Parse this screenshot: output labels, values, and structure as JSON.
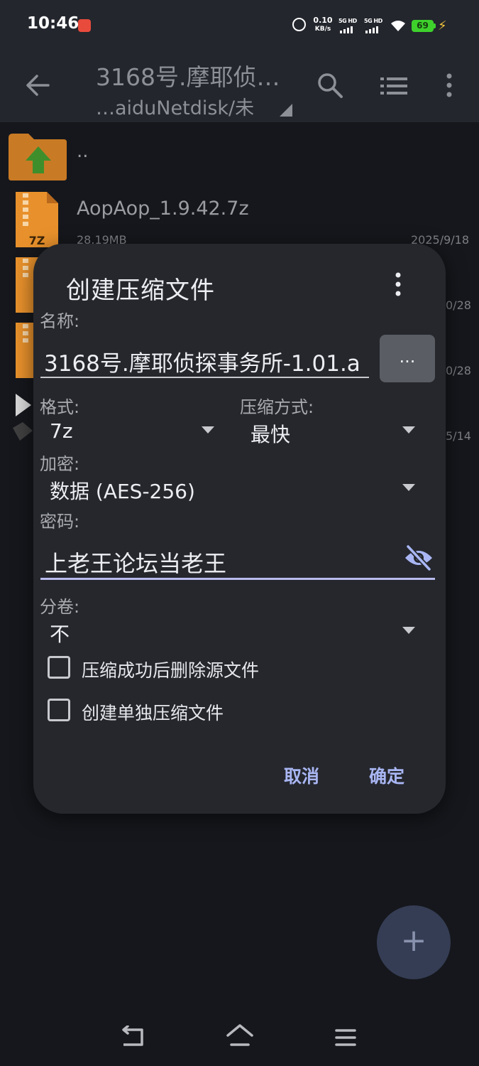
{
  "status_bar": {
    "time": "10:46",
    "net_speed_value": "0.10",
    "net_speed_unit": "KB/s",
    "sim1_tag": "5G HD",
    "sim2_tag": "5G HD",
    "battery_level": "69",
    "icons": [
      "alarm-icon",
      "wifi-icon",
      "charging-bolt-icon"
    ]
  },
  "app_bar": {
    "title": "3168号.摩耶侦…",
    "path": "…aiduNetdisk/未",
    "icons": [
      "back-arrow-icon",
      "search-icon",
      "view-list-icon",
      "more-vert-icon"
    ]
  },
  "file_list": {
    "parent_label": "..",
    "items": [
      {
        "name": "AopAop_1.9.42.7z",
        "size": "28.19MB",
        "date": "2025/9/18"
      },
      {
        "date": "0/28"
      },
      {
        "date": "0/28"
      },
      {
        "date": "5/14"
      }
    ],
    "archive_icon_label": "7Z"
  },
  "dialog": {
    "title": "创建压缩文件",
    "name_label": "名称:",
    "name_value": "3168号.摩耶侦探事务所-1.01.a",
    "browse_label": "...",
    "format_label": "格式:",
    "format_value": "7z",
    "method_label": "压缩方式:",
    "method_value": "最快",
    "encrypt_label": "加密:",
    "encrypt_value": "数据 (AES-256)",
    "password_label": "密码:",
    "password_value": "上老王论坛当老王",
    "split_label": "分卷:",
    "split_value": "不",
    "delete_source_label": "压缩成功后删除源文件",
    "delete_source_checked": false,
    "separate_archive_label": "创建单独压缩文件",
    "separate_archive_checked": false,
    "cancel_label": "取消",
    "ok_label": "确定"
  },
  "fab": {
    "label": "+"
  },
  "colors": {
    "background": "#15171c",
    "app_bar": "#23262d",
    "dialog": "#25272d",
    "accent": "#a9b6f3",
    "fab": "#353d54",
    "battery": "#3ed12c",
    "archive_icon": "#e8912c"
  }
}
